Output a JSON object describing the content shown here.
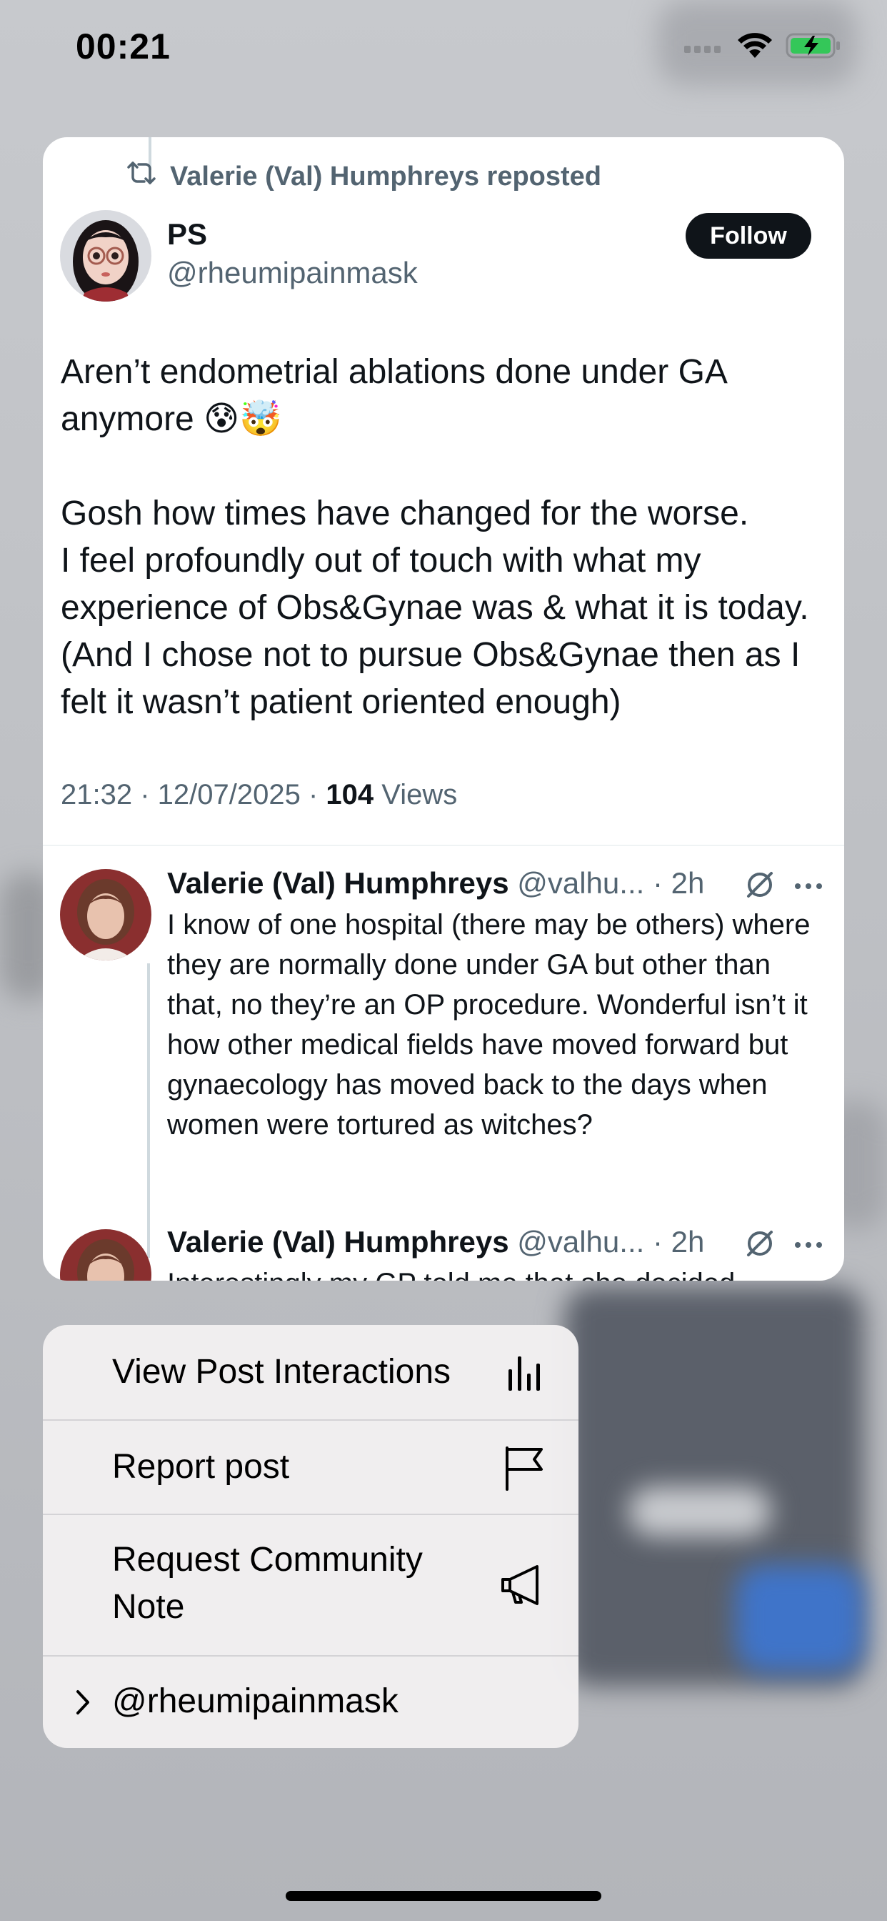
{
  "status_bar": {
    "time": "00:21"
  },
  "post": {
    "repost_label": "Valerie (Val) Humphreys reposted",
    "author_name": "PS",
    "author_handle": "@rheumipainmask",
    "follow_label": "Follow",
    "text": "Aren’t endometrial ablations done under GA anymore 😰🤯\n\nGosh how times have changed for the worse.\nI feel profoundly out of touch with what my experience of Obs&Gynae was & what it is today. (And I chose not to pursue Obs&Gynae then as I felt it wasn’t patient oriented enough)",
    "timestamp": "21:32 · 12/07/2025 · ",
    "views_count": "104",
    "views_label": " Views"
  },
  "replies": [
    {
      "name": "Valerie (Val) Humphreys",
      "meta": " @valhu... · 2h",
      "text": "I know of one hospital (there may be others) where they are normally done under GA but other than that, no they’re an OP procedure. Wonderful isn’t it how other medical fields have moved forward but gynaecology has moved back to the days when women were tortured as witches?"
    },
    {
      "name": "Valerie (Val) Humphreys",
      "meta": " @valhu... · 2h",
      "text": "Interestingly my GP told me that she decided"
    }
  ],
  "menu": {
    "items": [
      {
        "label": "View Post Interactions",
        "icon": "bar-chart-icon"
      },
      {
        "label": "Report post",
        "icon": "flag-icon"
      },
      {
        "label": "Request Community Note",
        "icon": "megaphone-icon"
      },
      {
        "label": "@rheumipainmask",
        "icon": "chevron-right-icon"
      }
    ]
  },
  "colors": {
    "text_primary": "#0f1419",
    "text_secondary": "#536471",
    "follow_button": "#0f1419",
    "menu_background": "#f2f0f1",
    "battery_green": "#34c759"
  }
}
